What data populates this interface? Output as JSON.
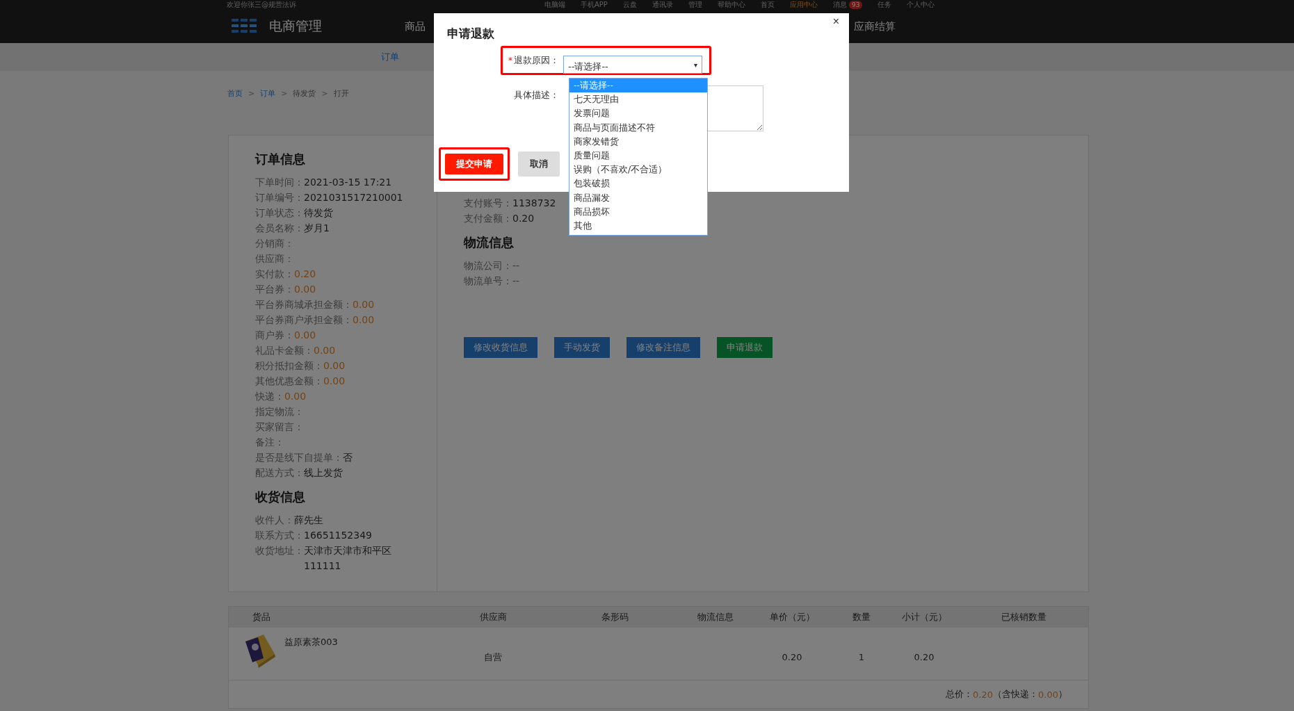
{
  "top_strip": {
    "welcome": "欢迎你张三@规营法诉",
    "links": [
      {
        "label": "电脑端",
        "selected": false
      },
      {
        "label": "手机APP",
        "selected": false
      },
      {
        "label": "云盘",
        "selected": false
      },
      {
        "label": "通讯录",
        "selected": false
      },
      {
        "label": "管理",
        "selected": false
      },
      {
        "label": "帮助中心",
        "selected": false
      },
      {
        "label": "首页",
        "selected": false
      },
      {
        "label": "应用中心",
        "selected": true
      },
      {
        "label": "消息",
        "selected": false,
        "badge": "93"
      },
      {
        "label": "任务",
        "selected": false
      },
      {
        "label": "个人中心",
        "selected": false
      }
    ]
  },
  "header": {
    "brand": "电商管理",
    "nav": [
      {
        "label": "商品"
      },
      {
        "label": "应商结算"
      }
    ]
  },
  "subnav": [
    {
      "label": "订单",
      "selected": true
    }
  ],
  "breadcrumb": [
    {
      "label": "首页",
      "link": true
    },
    {
      "separator": ">",
      "label": "订单",
      "link": true
    },
    {
      "separator": ">",
      "label": "待发货",
      "link": false
    },
    {
      "separator": ">",
      "label": "打开",
      "link": false
    }
  ],
  "order_info": {
    "title": "订单信息",
    "rows": [
      {
        "label": "下单时间：",
        "value": "2021-03-15 17:21",
        "kind": "text"
      },
      {
        "label": "订单编号：",
        "value": "2021031517210001",
        "kind": "text"
      },
      {
        "label": "订单状态：",
        "value": "待发货",
        "kind": "text"
      },
      {
        "label": "会员名称：",
        "value": "岁月1",
        "kind": "text"
      },
      {
        "label": "分销商："
      },
      {
        "label": "供应商："
      },
      {
        "label": "实付款：",
        "value": "0.20",
        "kind": "amount"
      },
      {
        "label": "平台券：",
        "value": "0.00",
        "kind": "amount"
      },
      {
        "label": "平台券商城承担金额：",
        "value": "0.00",
        "kind": "amount"
      },
      {
        "label": "平台券商户承担金额：",
        "value": "0.00",
        "kind": "amount"
      },
      {
        "label": "商户券：",
        "value": "0.00",
        "kind": "amount"
      },
      {
        "label": "礼品卡金额：",
        "value": "0.00",
        "kind": "amount"
      },
      {
        "label": "积分抵扣金额：",
        "value": "0.00",
        "kind": "amount"
      },
      {
        "label": "其他优惠金额：",
        "value": "0.00",
        "kind": "amount"
      },
      {
        "label": "快递：",
        "value": "0.00",
        "kind": "amount"
      },
      {
        "label": "指定物流："
      },
      {
        "label": "买家留言："
      },
      {
        "label": "备注："
      },
      {
        "label": "是否是线下自提单：",
        "value": "否",
        "kind": "text"
      },
      {
        "label": "配送方式：",
        "value": "线上发货",
        "kind": "text"
      }
    ]
  },
  "receiver_info": {
    "title": "收货信息",
    "rows": [
      {
        "label": "收件人：",
        "value": "薛先生"
      },
      {
        "label": "联系方式：",
        "value": "16651152349"
      },
      {
        "label": "收货地址：",
        "value": "天津市天津市和平区 111111"
      }
    ]
  },
  "payment_info": {
    "rows": [
      {
        "label": "支付账号：",
        "value": "1138732"
      },
      {
        "label": "支付金额：",
        "value": "0.20"
      }
    ]
  },
  "logistics_info": {
    "title": "物流信息",
    "rows": [
      {
        "text": "物流公司：--"
      },
      {
        "text": "物流单号：--"
      }
    ]
  },
  "actions": [
    {
      "label": "修改收货信息",
      "kind": "edit"
    },
    {
      "label": "手动发货",
      "kind": "edit"
    },
    {
      "label": "修改备注信息",
      "kind": "edit"
    },
    {
      "label": "申请退款",
      "kind": "refund"
    }
  ],
  "table": {
    "columns": [
      "货品",
      "供应商",
      "条形码",
      "物流信息",
      "单价（元）",
      "数量",
      "小计（元）",
      "已核销数量"
    ],
    "rows": [
      {
        "product": "益原素茶003",
        "supplier": "自营",
        "unit_price": "0.20",
        "quantity": "1",
        "subtotal": "0.20"
      }
    ],
    "total": {
      "label": "总价：",
      "value": "0.20",
      "shipping_label": "（含快递：",
      "shipping": "0.00",
      "close": "）"
    }
  },
  "dialog": {
    "title": "申请退款",
    "close": "×",
    "reason": {
      "required_mark": "*",
      "label": "退款原因：",
      "value": "--请选择--",
      "caret": "▾",
      "expanded": true,
      "options": [
        {
          "label": "--请选择--",
          "selected": true
        },
        {
          "label": "七天无理由",
          "selected": false
        },
        {
          "label": "发票问题",
          "selected": false
        },
        {
          "label": "商品与页面描述不符",
          "selected": false
        },
        {
          "label": "商家发错货",
          "selected": false
        },
        {
          "label": "质量问题",
          "selected": false
        },
        {
          "label": "误购（不喜欢/不合适）",
          "selected": false
        },
        {
          "label": "包装破损",
          "selected": false
        },
        {
          "label": "商品漏发",
          "selected": false
        },
        {
          "label": "商品损坏",
          "selected": false
        },
        {
          "label": "其他",
          "selected": false
        }
      ]
    },
    "description": {
      "label": "具体描述："
    },
    "buttons": [
      {
        "label": "提交申请",
        "kind": "primary"
      },
      {
        "label": "取消",
        "kind": "secondary"
      }
    ]
  }
}
